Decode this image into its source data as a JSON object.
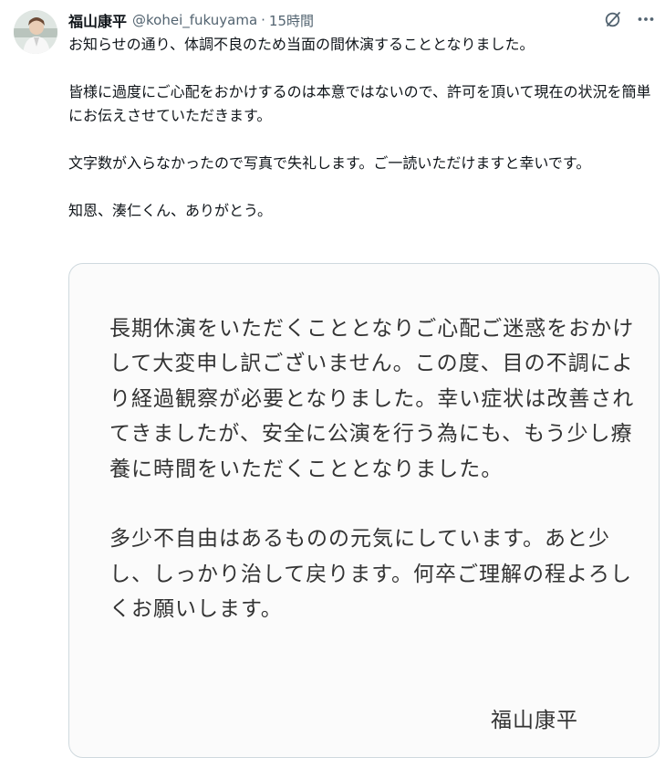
{
  "author": {
    "display_name": "福山康平",
    "handle": "@kohei_fukuyama",
    "separator": "·",
    "time": "15時間"
  },
  "tweet": {
    "paragraphs": [
      "お知らせの通り、体調不良のため当面の間休演することとなりました。",
      "皆様に過度にご心配をおかけするのは本意ではないので、許可を頂いて現在の状況を簡単にお伝えさせていただきます。",
      "文字数が入らなかったので写真で失礼します。ご一読いただけますと幸いです。",
      "知恩、湊仁くん、ありがとう。"
    ]
  },
  "image_note": {
    "paragraphs": [
      "長期休演をいただくこととなりご心配ご迷惑をおかけして大変申し訳ございません。この度、目の不調により経過観察が必要となりました。幸い症状は改善されてきましたが、安全に公演を行う為にも、もう少し療養に時間をいただくこととなりました。",
      "多少不自由はあるものの元気にしています。あと少し、しっかり治して戻ります。何卒ご理解の程よろしくお願いします。"
    ],
    "signature": "福山康平"
  },
  "icons": {
    "grok": "grok-icon",
    "more": "more-icon"
  },
  "colors": {
    "text": "#0f1419",
    "secondary": "#536471",
    "border": "#cfd9de"
  }
}
